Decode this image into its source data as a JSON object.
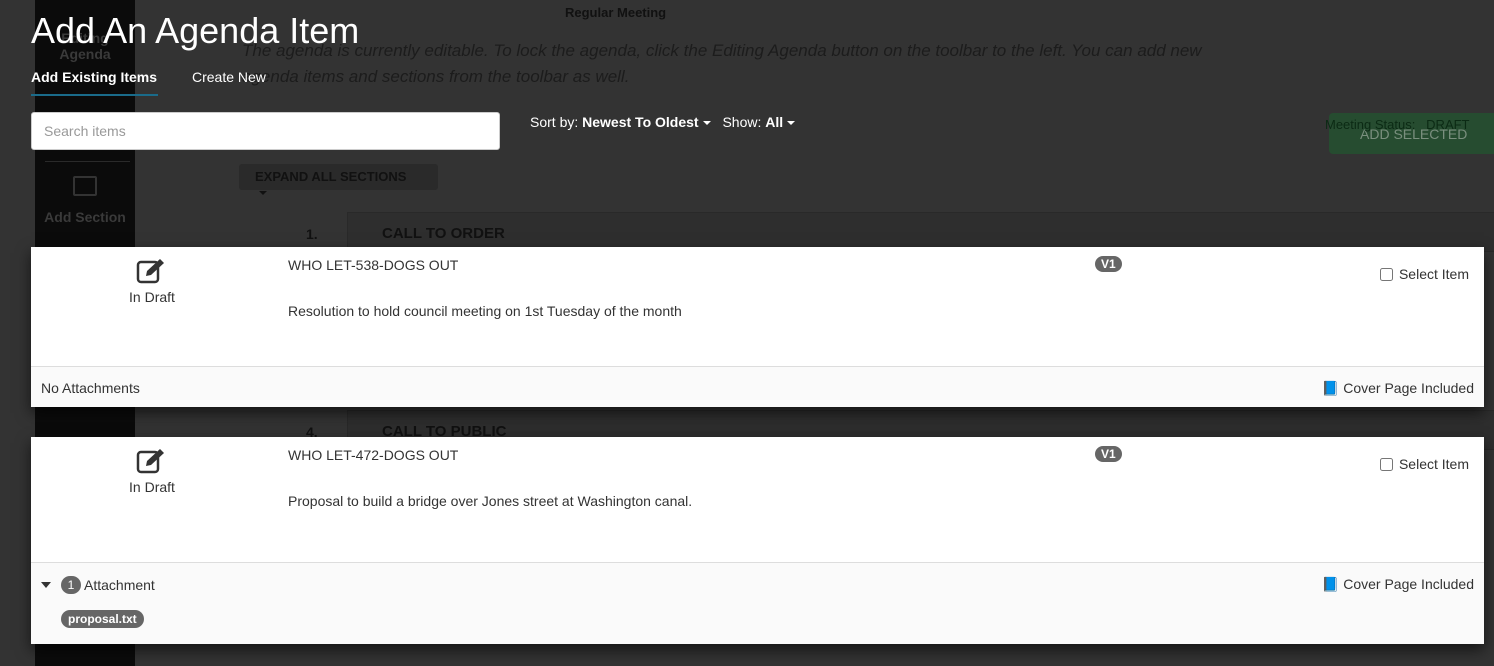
{
  "background": {
    "meeting_title": "Regular Meeting",
    "notice": "The agenda is currently editable. To lock the agenda, click the Editing Agenda button on the toolbar to the left. You can add new agenda items and sections from the toolbar as well.",
    "sidebar": {
      "editing_agenda": "Editing Agenda",
      "add_section": "Add Section"
    },
    "expand_all": "EXPAND ALL SECTIONS",
    "meeting_status_label": "Meeting Status:",
    "meeting_status_value": "DRAFT",
    "sections": [
      {
        "num": "1.",
        "title": "CALL TO ORDER"
      },
      {
        "num": "4.",
        "title": "CALL TO PUBLIC"
      }
    ]
  },
  "modal": {
    "title": "Add An Agenda Item",
    "tabs": [
      {
        "label": "Add Existing Items",
        "active": true
      },
      {
        "label": "Create New",
        "active": false
      }
    ],
    "search_placeholder": "Search items",
    "sort_label": "Sort by:",
    "sort_value": "Newest To Oldest",
    "show_label": "Show:",
    "show_value": "All",
    "add_selected": "ADD SELECTED",
    "accent": "#1a6b8a",
    "items": [
      {
        "status": "In Draft",
        "title": "WHO LET-538-DOGS OUT",
        "version": "V1",
        "select_label": "Select Item",
        "description": "Resolution to hold council meeting on 1st Tuesday of the month",
        "attachments_label": "No Attachments",
        "cover": "Cover Page Included"
      },
      {
        "status": "In Draft",
        "title": "WHO LET-472-DOGS OUT",
        "version": "V1",
        "select_label": "Select Item",
        "description": "Proposal to build a bridge over Jones street at Washington canal.",
        "attachment_count": "1",
        "attachments_label": "Attachment",
        "files": [
          "proposal.txt"
        ],
        "cover": "Cover Page Included"
      }
    ]
  }
}
